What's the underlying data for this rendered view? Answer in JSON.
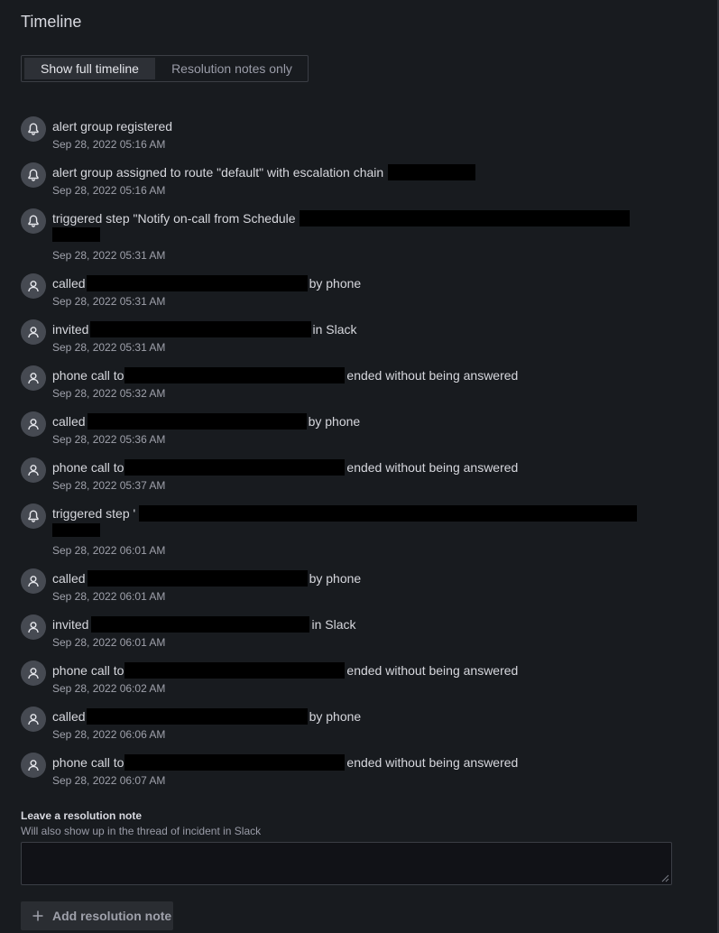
{
  "title": "Timeline",
  "toggle": {
    "options": [
      "Show full timeline",
      "Resolution notes only"
    ],
    "selected": "Show full timeline"
  },
  "timeline": [
    {
      "icon": "bell-icon",
      "text": "alert group registered",
      "time": "Sep 28, 2022 05:16 AM"
    },
    {
      "icon": "bell-icon",
      "prefix": "alert group assigned to route \"default\" with escalation chain",
      "suffix": "",
      "time": "Sep 28, 2022 05:16 AM"
    },
    {
      "icon": "bell-icon",
      "prefix": "triggered step \"Notify on-call from Schedule",
      "suffix": "",
      "time": "Sep 28, 2022 05:31 AM"
    },
    {
      "icon": "user-icon",
      "prefix": "called",
      "suffix": "by phone",
      "time": "Sep 28, 2022 05:31 AM"
    },
    {
      "icon": "user-icon",
      "prefix": "invited",
      "suffix": "in Slack",
      "time": "Sep 28, 2022 05:31 AM"
    },
    {
      "icon": "user-icon",
      "prefix": "phone call to",
      "suffix": "ended without being answered",
      "time": "Sep 28, 2022 05:32 AM"
    },
    {
      "icon": "user-icon",
      "prefix": "called",
      "suffix": "by phone",
      "time": "Sep 28, 2022 05:36 AM"
    },
    {
      "icon": "user-icon",
      "prefix": "phone call to",
      "suffix": "ended without being answered",
      "time": "Sep 28, 2022 05:37 AM"
    },
    {
      "icon": "bell-icon",
      "prefix": "triggered step '",
      "suffix": "",
      "time": "Sep 28, 2022 06:01 AM"
    },
    {
      "icon": "user-icon",
      "prefix": "called",
      "suffix": "by phone",
      "time": "Sep 28, 2022 06:01 AM"
    },
    {
      "icon": "user-icon",
      "prefix": "invited",
      "suffix": "in Slack",
      "time": "Sep 28, 2022 06:01 AM"
    },
    {
      "icon": "user-icon",
      "prefix": "phone call to",
      "suffix": "ended without being answered",
      "time": "Sep 28, 2022 06:02 AM"
    },
    {
      "icon": "user-icon",
      "prefix": "called",
      "suffix": "by phone",
      "time": "Sep 28, 2022 06:06 AM"
    },
    {
      "icon": "user-icon",
      "prefix": "phone call to",
      "suffix": "ended without being answered",
      "time": "Sep 28, 2022 06:07 AM"
    }
  ],
  "resolution_note": {
    "label": "Leave a resolution note",
    "description": "Will also show up in the thread of incident in Slack",
    "value": "",
    "button_label": "Add resolution note"
  },
  "colors": {
    "background": "#181b1f",
    "icon_bg": "#464a52",
    "redaction": "#000000"
  }
}
